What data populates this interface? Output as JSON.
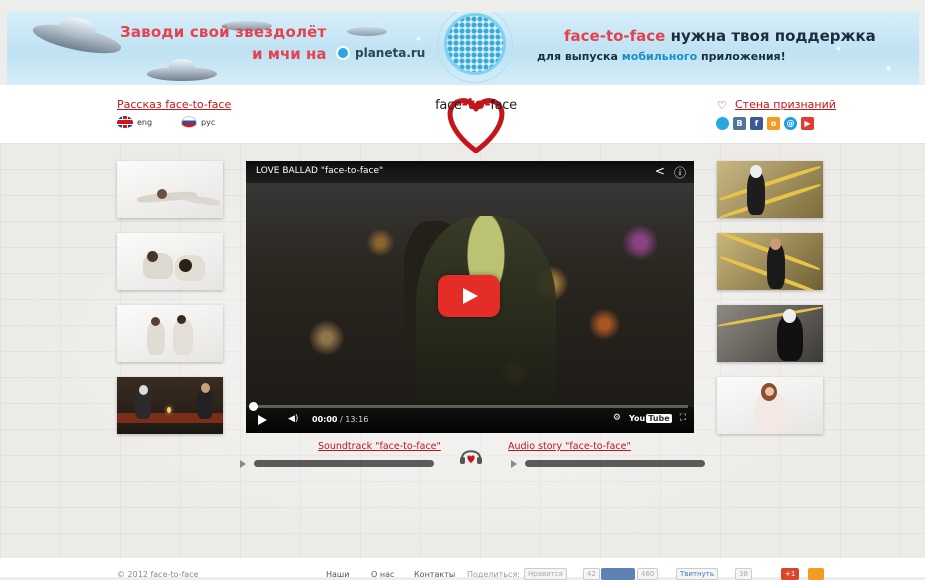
{
  "banner": {
    "left_line1": "Заводи свой звездолёт",
    "left_line2": "и мчи на",
    "planeta": "planeta.ru",
    "right_line1_hl": "face-to-face",
    "right_line1_rest": " нужна твоя поддержка",
    "right_line2_a": "для выпуска ",
    "right_line2_hl": "мобильного",
    "right_line2_b": " приложения!"
  },
  "header": {
    "story_link": "Рассказ face-to-face",
    "lang_en": "eng",
    "lang_ru": "рус",
    "logo_left": "face",
    "logo_mid": "-to-",
    "logo_right": "face",
    "wall_link": "Стена признаний",
    "socials": [
      {
        "name": "planeta",
        "label": "",
        "color": "#2aa6e0"
      },
      {
        "name": "vk",
        "label": "В",
        "color": "#4d76a1"
      },
      {
        "name": "facebook",
        "label": "f",
        "color": "#3b5998"
      },
      {
        "name": "odnoklassniki",
        "label": "о",
        "color": "#f59a23"
      },
      {
        "name": "mail",
        "label": "@",
        "color": "#1e9ce8"
      },
      {
        "name": "youtube",
        "label": "▶",
        "color": "#e33b2e"
      }
    ]
  },
  "video": {
    "title": "LOVE BALLAD \"face-to-face\"",
    "time_current": "00:00",
    "time_total": " / 13:16",
    "youtube_label": "You",
    "youtube_tube": "Tube"
  },
  "audio": {
    "soundtrack": "Soundtrack \"face-to-face\"",
    "story": "Audio story \"face-to-face\""
  },
  "footer": {
    "copyright": "© 2012 face-to-face",
    "links": [
      "Наши",
      "О нас",
      "Контакты"
    ],
    "share_label": "Поделиться:",
    "btn_like": "Нравится",
    "count_like": "42",
    "count_2": "460",
    "btn_tweet": "Твитнуть",
    "count_tweet": "38",
    "btn_gplus": "+1"
  },
  "colors": {
    "accent_red": "#c4141c",
    "banner_red": "#e5424f",
    "youtube_red": "#e52d27"
  }
}
